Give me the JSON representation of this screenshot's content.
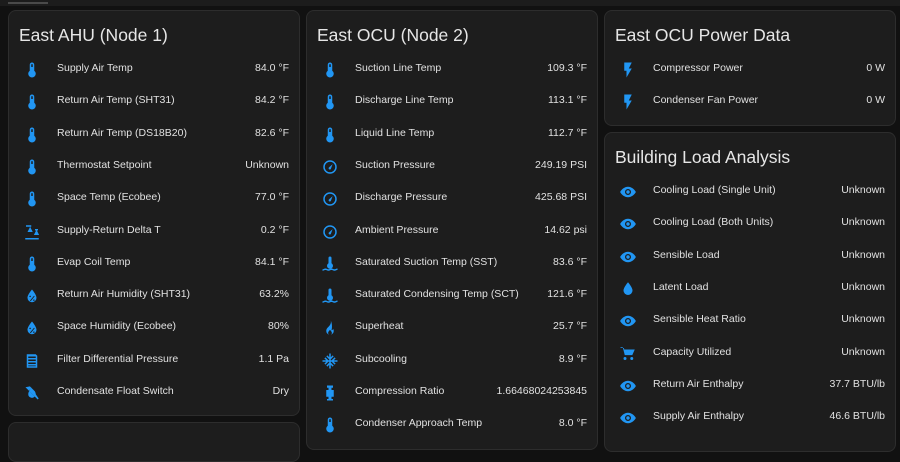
{
  "colors": {
    "icon": "#2196f3",
    "card": "#1d1d1d",
    "background": "#111111"
  },
  "cards": {
    "ahu": {
      "title": "East AHU (Node 1)",
      "rows": [
        {
          "icon": "thermometer-icon",
          "label": "Supply Air Temp",
          "value": "84.0 °F"
        },
        {
          "icon": "thermometer-icon",
          "label": "Return Air Temp (SHT31)",
          "value": "84.2 °F"
        },
        {
          "icon": "thermometer-icon",
          "label": "Return Air Temp (DS18B20)",
          "value": "82.6 °F"
        },
        {
          "icon": "thermometer-icon",
          "label": "Thermostat Setpoint",
          "value": "Unknown"
        },
        {
          "icon": "thermometer-icon",
          "label": "Space Temp (Ecobee)",
          "value": "77.0 °F"
        },
        {
          "icon": "delta-scale-icon",
          "label": "Supply-Return Delta T",
          "value": "0.2 °F"
        },
        {
          "icon": "thermometer-icon",
          "label": "Evap Coil Temp",
          "value": "84.1 °F"
        },
        {
          "icon": "water-percent-icon",
          "label": "Return Air Humidity (SHT31)",
          "value": "63.2%"
        },
        {
          "icon": "water-percent-icon",
          "label": "Space Humidity (Ecobee)",
          "value": "80%"
        },
        {
          "icon": "air-filter-icon",
          "label": "Filter Differential Pressure",
          "value": "1.1 Pa"
        },
        {
          "icon": "water-off-icon",
          "label": "Condensate Float Switch",
          "value": "Dry"
        }
      ]
    },
    "ocu": {
      "title": "East OCU (Node 2)",
      "rows": [
        {
          "icon": "thermometer-icon",
          "label": "Suction Line Temp",
          "value": "109.3 °F"
        },
        {
          "icon": "thermometer-icon",
          "label": "Discharge Line Temp",
          "value": "113.1 °F"
        },
        {
          "icon": "thermometer-icon",
          "label": "Liquid Line Temp",
          "value": "112.7 °F"
        },
        {
          "icon": "gauge-icon",
          "label": "Suction Pressure",
          "value": "249.19 PSI"
        },
        {
          "icon": "gauge-icon",
          "label": "Discharge Pressure",
          "value": "425.68 PSI"
        },
        {
          "icon": "gauge-icon",
          "label": "Ambient Pressure",
          "value": "14.62 psi"
        },
        {
          "icon": "thermometer-water-icon",
          "label": "Saturated Suction Temp (SST)",
          "value": "83.6 °F"
        },
        {
          "icon": "thermometer-water-icon",
          "label": "Saturated Condensing Temp (SCT)",
          "value": "121.6 °F"
        },
        {
          "icon": "fire-icon",
          "label": "Superheat",
          "value": "25.7 °F"
        },
        {
          "icon": "snowflake-icon",
          "label": "Subcooling",
          "value": "8.9 °F"
        },
        {
          "icon": "pump-icon",
          "label": "Compression Ratio",
          "value": "1.66468024253845"
        },
        {
          "icon": "thermometer-icon",
          "label": "Condenser Approach Temp",
          "value": "8.0 °F"
        }
      ]
    },
    "power": {
      "title": "East OCU Power Data",
      "rows": [
        {
          "icon": "flash-icon",
          "label": "Compressor Power",
          "value": "0 W"
        },
        {
          "icon": "flash-icon",
          "label": "Condenser Fan Power",
          "value": "0 W"
        }
      ]
    },
    "load": {
      "title": "Building Load Analysis",
      "rows": [
        {
          "icon": "eye-icon",
          "label": "Cooling Load (Single Unit)",
          "value": "Unknown"
        },
        {
          "icon": "eye-icon",
          "label": "Cooling Load (Both Units)",
          "value": "Unknown"
        },
        {
          "icon": "eye-icon",
          "label": "Sensible Load",
          "value": "Unknown"
        },
        {
          "icon": "water-drop-icon",
          "label": "Latent Load",
          "value": "Unknown"
        },
        {
          "icon": "eye-icon",
          "label": "Sensible Heat Ratio",
          "value": "Unknown"
        },
        {
          "icon": "cart-icon",
          "label": "Capacity Utilized",
          "value": "Unknown"
        },
        {
          "icon": "eye-icon",
          "label": "Return Air Enthalpy",
          "value": "37.7 BTU/lb"
        },
        {
          "icon": "eye-icon",
          "label": "Supply Air Enthalpy",
          "value": "46.6 BTU/lb"
        }
      ]
    }
  }
}
